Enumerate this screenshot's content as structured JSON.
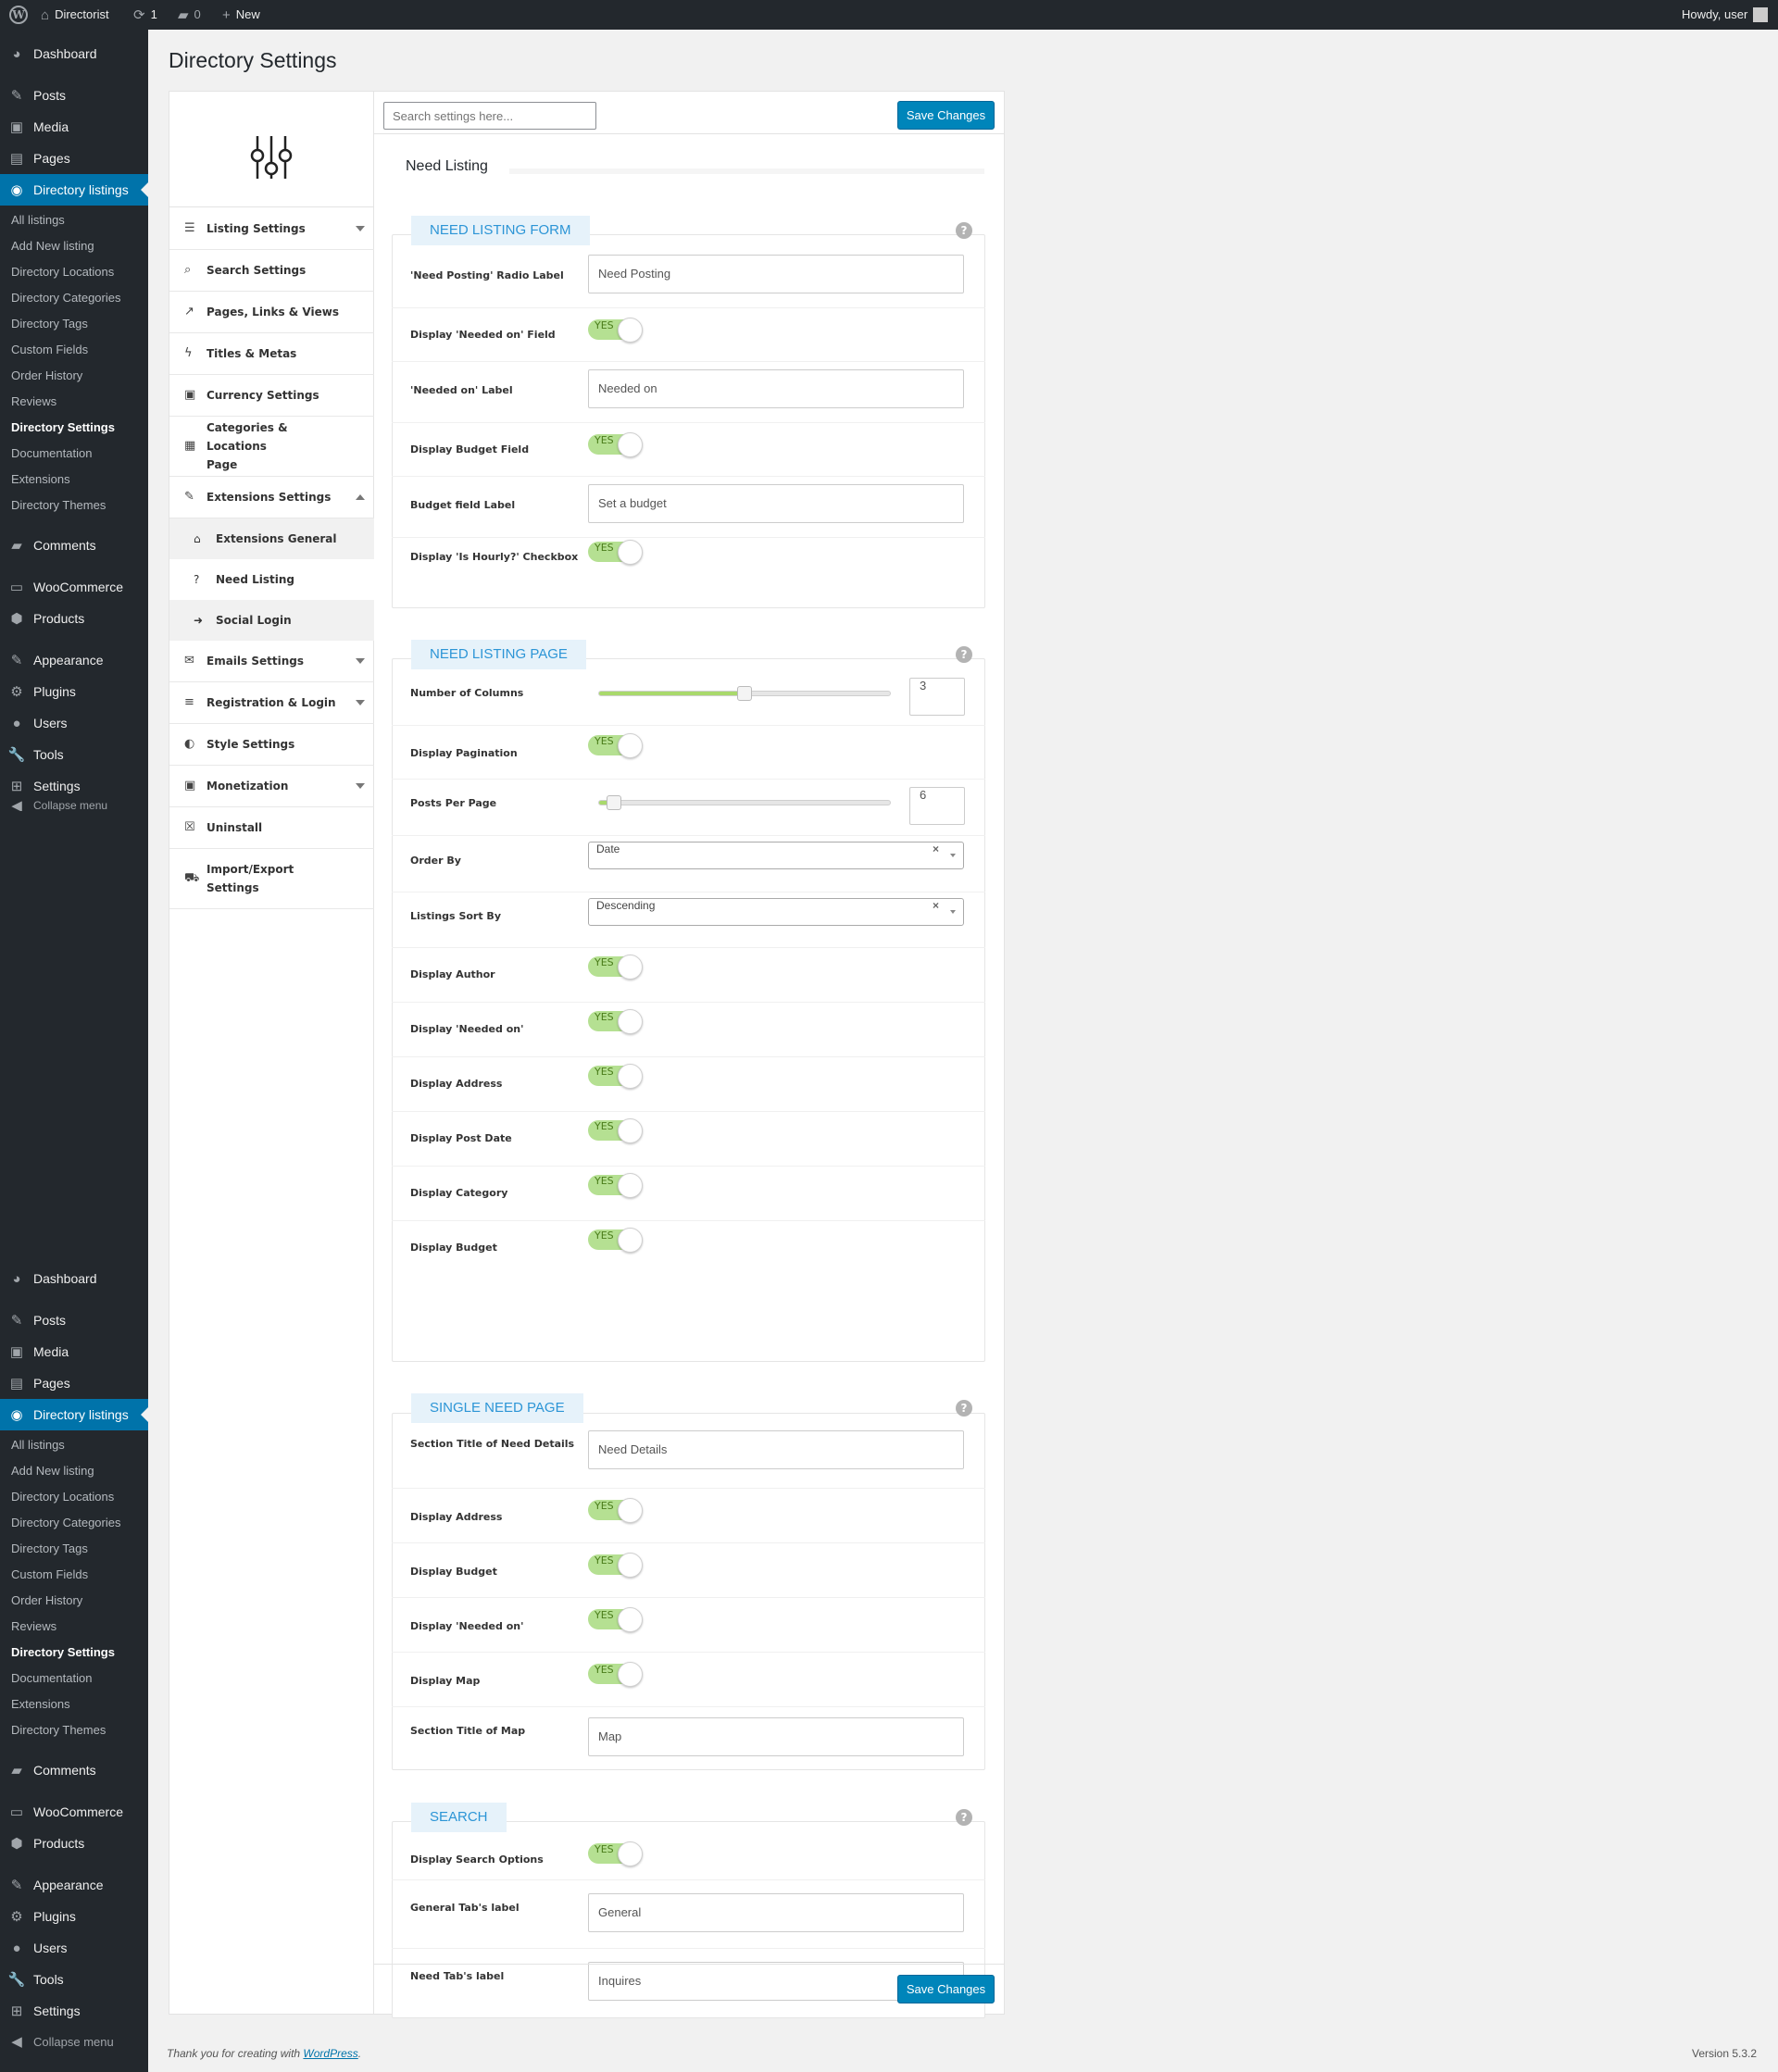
{
  "adminbar": {
    "site_name": "Directorist",
    "updates_count": "1",
    "comments_count": "0",
    "new_label": "New",
    "howdy": "Howdy, user"
  },
  "menu": {
    "main_top": [
      "Dashboard",
      "Posts",
      "Media",
      "Pages"
    ],
    "current": "Directory listings",
    "submenu": [
      "All listings",
      "Add New listing",
      "Directory Locations",
      "Directory Categories",
      "Directory Tags",
      "Custom Fields",
      "Order History",
      "Reviews",
      "Directory Settings",
      "Documentation",
      "Extensions",
      "Directory Themes"
    ],
    "main_bottom": [
      "Comments",
      "WooCommerce",
      "Products",
      "Appearance",
      "Plugins",
      "Users",
      "Tools",
      "Settings"
    ],
    "collapse": "Collapse menu",
    "collapse_partial": "Collapse menu"
  },
  "page": {
    "title": "Directory Settings",
    "search_placeholder": "Search settings here...",
    "save_label": "Save Changes",
    "content_title": "Need Listing"
  },
  "nav": {
    "items": [
      {
        "label": "Listing Settings",
        "icon": "list-icon"
      },
      {
        "label": "Search Settings",
        "icon": "search-icon"
      },
      {
        "label": "Pages, Links & Views",
        "icon": "chart-icon"
      },
      {
        "label": "Titles & Metas",
        "icon": "bolt-icon"
      },
      {
        "label": "Currency Settings",
        "icon": "money-icon"
      },
      {
        "label": "Categories & Locations Page",
        "icon": "table-icon"
      },
      {
        "label": "Extensions Settings",
        "icon": "magic-icon"
      },
      {
        "label": "Emails Settings",
        "icon": "envelope-icon"
      },
      {
        "label": "Registration & Login",
        "icon": "align-icon"
      },
      {
        "label": "Style Settings",
        "icon": "contrast-icon"
      },
      {
        "label": "Monetization",
        "icon": "money-icon"
      },
      {
        "label": "Uninstall",
        "icon": "close-box-icon"
      },
      {
        "label": "Import/Export Settings",
        "icon": "truck-icon"
      }
    ],
    "sub": [
      {
        "label": "Extensions General",
        "icon": "home-icon"
      },
      {
        "label": "Need Listing",
        "icon": "question-icon"
      },
      {
        "label": "Social Login",
        "icon": "sign-in-icon"
      }
    ]
  },
  "sections": {
    "form": {
      "title": "NEED LISTING FORM",
      "rows": [
        {
          "label": "'Need Posting' Radio Label",
          "value": "Need Posting"
        },
        {
          "label": "Display 'Needed on' Field",
          "toggle": "YES"
        },
        {
          "label": "'Needed on' Label",
          "value": "Needed on"
        },
        {
          "label": "Display Budget Field",
          "toggle": "YES"
        },
        {
          "label": "Budget field Label",
          "value": "Set a budget"
        },
        {
          "label": "Display 'Is Hourly?' Checkbox",
          "toggle": "YES"
        }
      ]
    },
    "listing_page": {
      "title": "NEED LISTING PAGE",
      "columns": {
        "label": "Number of Columns",
        "value": "3",
        "level": 0.5
      },
      "pagination": {
        "label": "Display Pagination",
        "toggle": "YES"
      },
      "per_page": {
        "label": "Posts Per Page",
        "value": "6",
        "level": 0.05
      },
      "order_by": {
        "label": "Order By",
        "value": "Date"
      },
      "sort_by": {
        "label": "Listings Sort By",
        "value": "Descending"
      },
      "toggles": [
        {
          "label": "Display Author",
          "toggle": "YES"
        },
        {
          "label": "Display 'Needed on'",
          "toggle": "YES"
        },
        {
          "label": "Display Address",
          "toggle": "YES"
        },
        {
          "label": "Display Post Date",
          "toggle": "YES"
        },
        {
          "label": "Display Category",
          "toggle": "YES"
        },
        {
          "label": "Display Budget",
          "toggle": "YES"
        }
      ]
    },
    "single": {
      "title": "SINGLE NEED PAGE",
      "rows": [
        {
          "label": "Section Title of Need Details",
          "value": "Need Details"
        },
        {
          "label": "Display Address",
          "toggle": "YES"
        },
        {
          "label": "Display Budget",
          "toggle": "YES"
        },
        {
          "label": "Display 'Needed on'",
          "toggle": "YES"
        },
        {
          "label": "Display Map",
          "toggle": "YES"
        },
        {
          "label": "Section Title of Map",
          "value": "Map"
        }
      ]
    },
    "search": {
      "title": "SEARCH",
      "rows": [
        {
          "label": "Display Search Options",
          "toggle": "YES"
        },
        {
          "label": "General Tab's label",
          "value": "General"
        },
        {
          "label": "Need Tab's label",
          "value": "Inquires"
        }
      ]
    }
  },
  "footer": {
    "thanks_prefix": "Thank you for creating with",
    "wp_link": "WordPress",
    "thanks_suffix": ".",
    "version": "Version 5.3.2"
  },
  "colors": {
    "accent": "#0073aa",
    "button": "#0085ba",
    "section_title": "#2c95d6",
    "toggle_on": "#b5e092"
  }
}
